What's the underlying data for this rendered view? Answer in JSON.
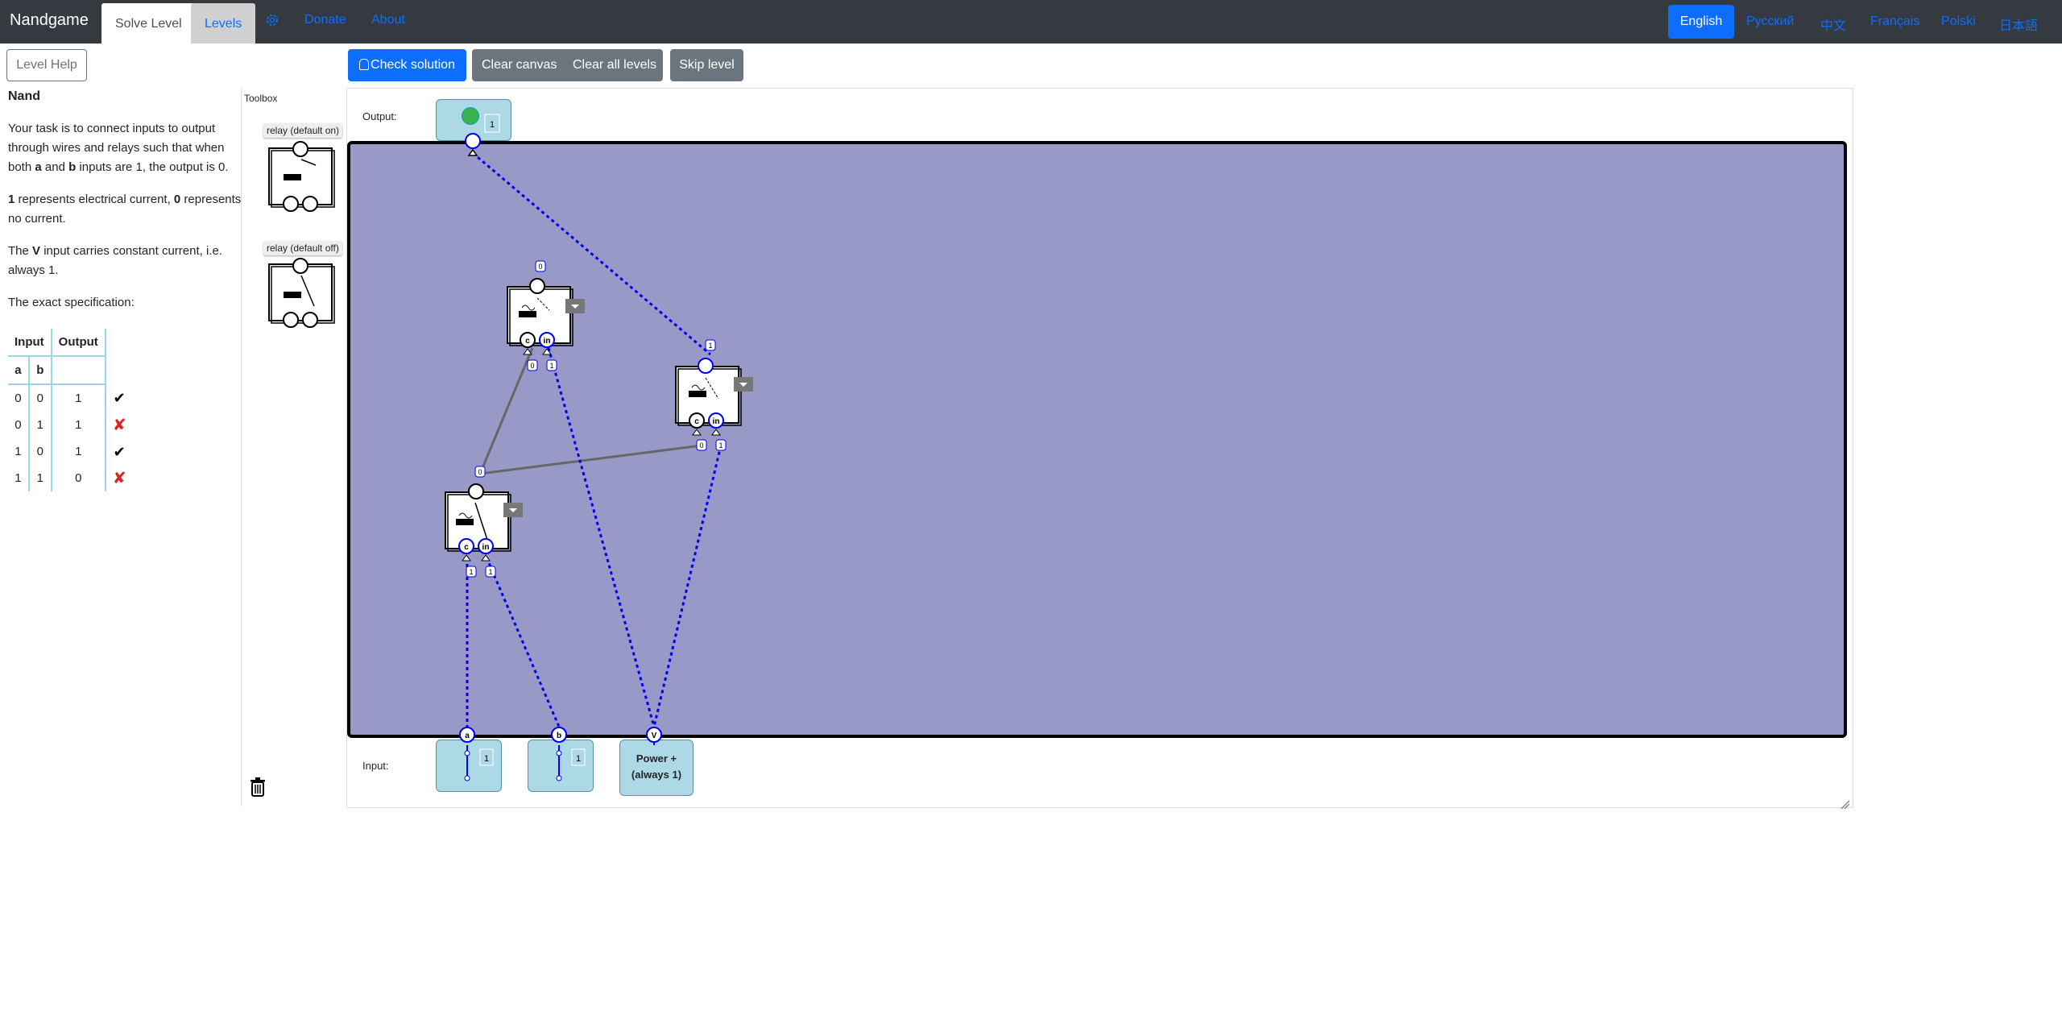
{
  "nav": {
    "brand": "Nandgame",
    "tabs": [
      "Solve Level",
      "Levels"
    ],
    "links": [
      "Donate",
      "About"
    ],
    "icons": {
      "settings": "gear-icon"
    },
    "languages": [
      "English",
      "Русский",
      "中文",
      "Français",
      "Polski",
      "日本語"
    ],
    "active_language": "English"
  },
  "toolbar": {
    "level_help": "Level Help",
    "check_solution": "Check solution",
    "clear_canvas": "Clear canvas",
    "clear_all_levels": "Clear all levels",
    "skip_level": "Skip level"
  },
  "level": {
    "title": "Nand",
    "description_parts": [
      "Your task is to connect inputs to output through wires and relays such that when both ",
      "a",
      " and ",
      "b",
      " inputs are 1, the output is 0."
    ],
    "current_parts": [
      "1",
      " represents electrical current, ",
      "0",
      " represents no current."
    ],
    "v_input_parts": [
      "The ",
      "V",
      " input carries constant current, i.e. always 1."
    ],
    "spec_intro": "The exact specification:",
    "spec": {
      "header_input": "Input",
      "header_output": "Output",
      "col_a": "a",
      "col_b": "b",
      "rows": [
        {
          "a": "0",
          "b": "0",
          "out": "1",
          "status": "ok"
        },
        {
          "a": "0",
          "b": "1",
          "out": "1",
          "status": "bad"
        },
        {
          "a": "1",
          "b": "0",
          "out": "1",
          "status": "ok"
        },
        {
          "a": "1",
          "b": "1",
          "out": "0",
          "status": "bad"
        }
      ]
    }
  },
  "toolbox": {
    "title": "Toolbox",
    "items": [
      "relay (default on)",
      "relay (default off)"
    ]
  },
  "workspace": {
    "output_label": "Output:",
    "input_label": "Input:",
    "output_value": "1",
    "inputs": [
      {
        "name": "a",
        "value": "1"
      },
      {
        "name": "b",
        "value": "1"
      }
    ],
    "power": {
      "pin": "V",
      "label": "Power + (always 1)"
    },
    "wire_labels": {
      "out_in": "1",
      "relay1_top": "0",
      "relay1_c": "0",
      "relay1_in": "1",
      "relay2_top": "1",
      "relay2_c": "0",
      "relay2_in": "1",
      "relay3_top": "0",
      "relay3_c": "1",
      "relay3_in": "1"
    },
    "pin_c": "c",
    "pin_in": "in",
    "colors": {
      "canvas": "#9999c8",
      "active_wire": "#0000ee",
      "inactive_wire": "#666666",
      "lamp_on": "#3cb44b",
      "node_fill": "#add8e6"
    }
  }
}
